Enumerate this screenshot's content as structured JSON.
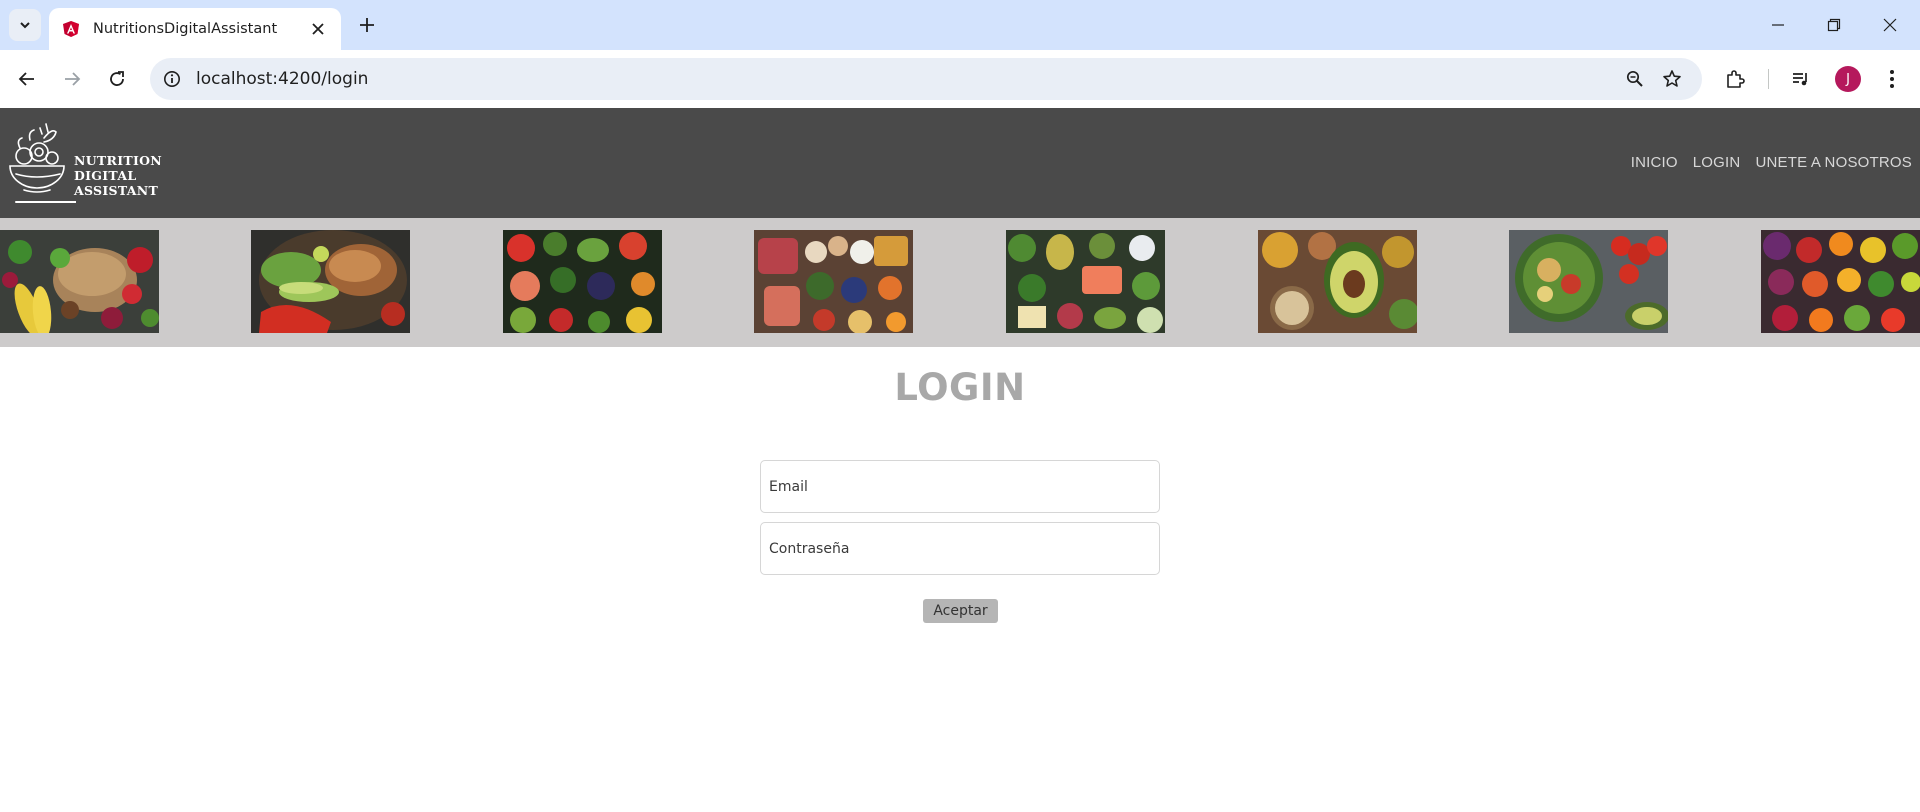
{
  "browser": {
    "tab_title": "NutritionsDigitalAssistant",
    "url": "localhost:4200/login",
    "profile_initial": "J"
  },
  "header": {
    "logo_lines": [
      "NUTRITION",
      "DIGITAL",
      "ASSISTANT"
    ],
    "nav": [
      "INICIO",
      "LOGIN",
      "UNETE A NOSOTROS"
    ]
  },
  "gallery": {
    "images": [
      "fruits-bread-vegetables",
      "salad-bowl-grilled-meat",
      "fruit-vegetable-assortment",
      "meat-eggs-legumes",
      "salmon-greens-oil",
      "avocado-nuts-seeds",
      "chickpea-salad-tomatoes",
      "colorful-fruits-vegetables"
    ]
  },
  "login": {
    "title": "LOGIN",
    "email_placeholder": "Email",
    "password_placeholder": "Contraseña",
    "submit_label": "Aceptar"
  },
  "colors": {
    "header_bg": "#4a4a4a",
    "gallery_bg": "#cdcbcb",
    "title_color": "#a8a8a8",
    "button_bg": "#b5b5b5",
    "chrome_tabstrip": "#d3e3fd"
  }
}
